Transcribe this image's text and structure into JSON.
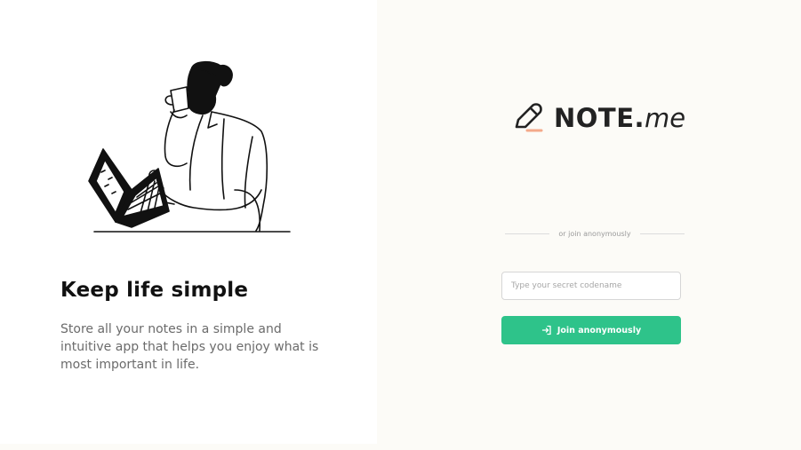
{
  "brand": {
    "name": "NOTE.",
    "suffix": "me",
    "icon": "pencil-icon",
    "accent_color": "#f4a98a"
  },
  "hero": {
    "illustration": "man-drinking-coffee-with-laptop-illustration",
    "tagline": "Keep life simple",
    "description": "Store all your notes in a simple and intuitive app that helps you enjoy what is most important in life."
  },
  "auth": {
    "divider_text": "or join anonymously",
    "codename_placeholder": "Type your secret codename",
    "codename_value": "",
    "join_button_label": "Join anonymously",
    "join_icon": "sign-in-icon",
    "button_color": "#2ec38a"
  }
}
